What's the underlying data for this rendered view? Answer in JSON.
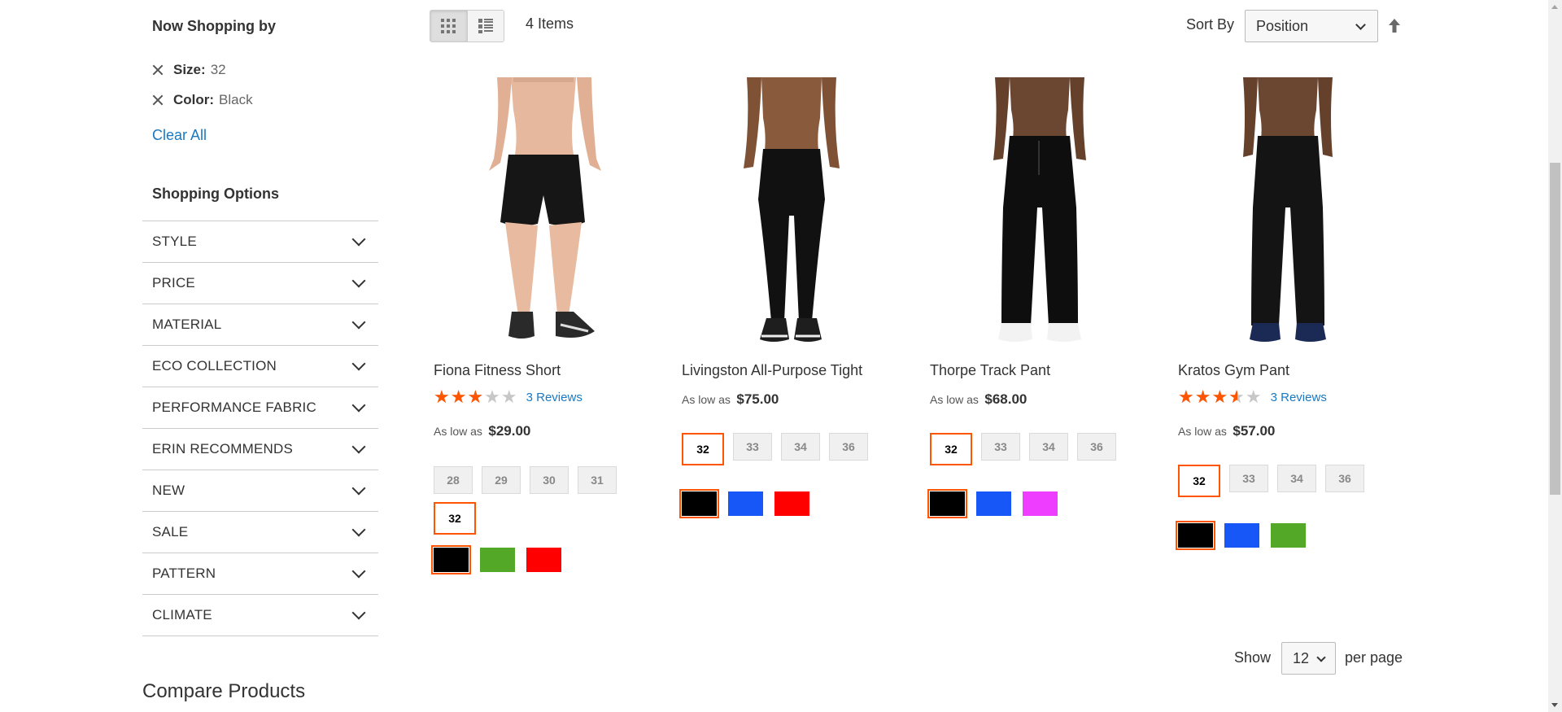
{
  "now_shopping": {
    "title": "Now Shopping by",
    "filters": [
      {
        "label": "Size:",
        "value": "32"
      },
      {
        "label": "Color:",
        "value": "Black"
      }
    ],
    "clear_all": "Clear All"
  },
  "shopping_options": {
    "title": "Shopping Options",
    "items": [
      "STYLE",
      "PRICE",
      "MATERIAL",
      "ECO COLLECTION",
      "PERFORMANCE FABRIC",
      "ERIN RECOMMENDS",
      "NEW",
      "SALE",
      "PATTERN",
      "CLIMATE"
    ]
  },
  "compare": {
    "title": "Compare Products"
  },
  "toolbar": {
    "item_count": "4 Items",
    "sort_label": "Sort By",
    "sort_value": "Position"
  },
  "products": [
    {
      "name": "Fiona Fitness Short",
      "rating": 0.6,
      "reviews": "3 Reviews",
      "price_label": "As low as",
      "price": "$29.00",
      "sizes": [
        "28",
        "29",
        "30",
        "31",
        "32"
      ],
      "selected_size": "32",
      "colors": [
        "#000000",
        "#53a828",
        "#ff0000"
      ],
      "selected_color": 0
    },
    {
      "name": "Livingston All-Purpose Tight",
      "price_label": "As low as",
      "price": "$75.00",
      "sizes": [
        "32",
        "33",
        "34",
        "36"
      ],
      "selected_size": "32",
      "colors": [
        "#000000",
        "#1857f7",
        "#ff0000"
      ],
      "selected_color": 0
    },
    {
      "name": "Thorpe Track Pant",
      "price_label": "As low as",
      "price": "$68.00",
      "sizes": [
        "32",
        "33",
        "34",
        "36"
      ],
      "selected_size": "32",
      "colors": [
        "#000000",
        "#1857f7",
        "#ef3dff"
      ],
      "selected_color": 0
    },
    {
      "name": "Kratos Gym Pant",
      "rating": 0.7,
      "reviews": "3 Reviews",
      "price_label": "As low as",
      "price": "$57.00",
      "sizes": [
        "32",
        "33",
        "34",
        "36"
      ],
      "selected_size": "32",
      "colors": [
        "#000000",
        "#1857f7",
        "#53a828"
      ],
      "selected_color": 0
    }
  ],
  "limiter": {
    "show_label": "Show",
    "value": "12",
    "per_page_label": "per page"
  }
}
